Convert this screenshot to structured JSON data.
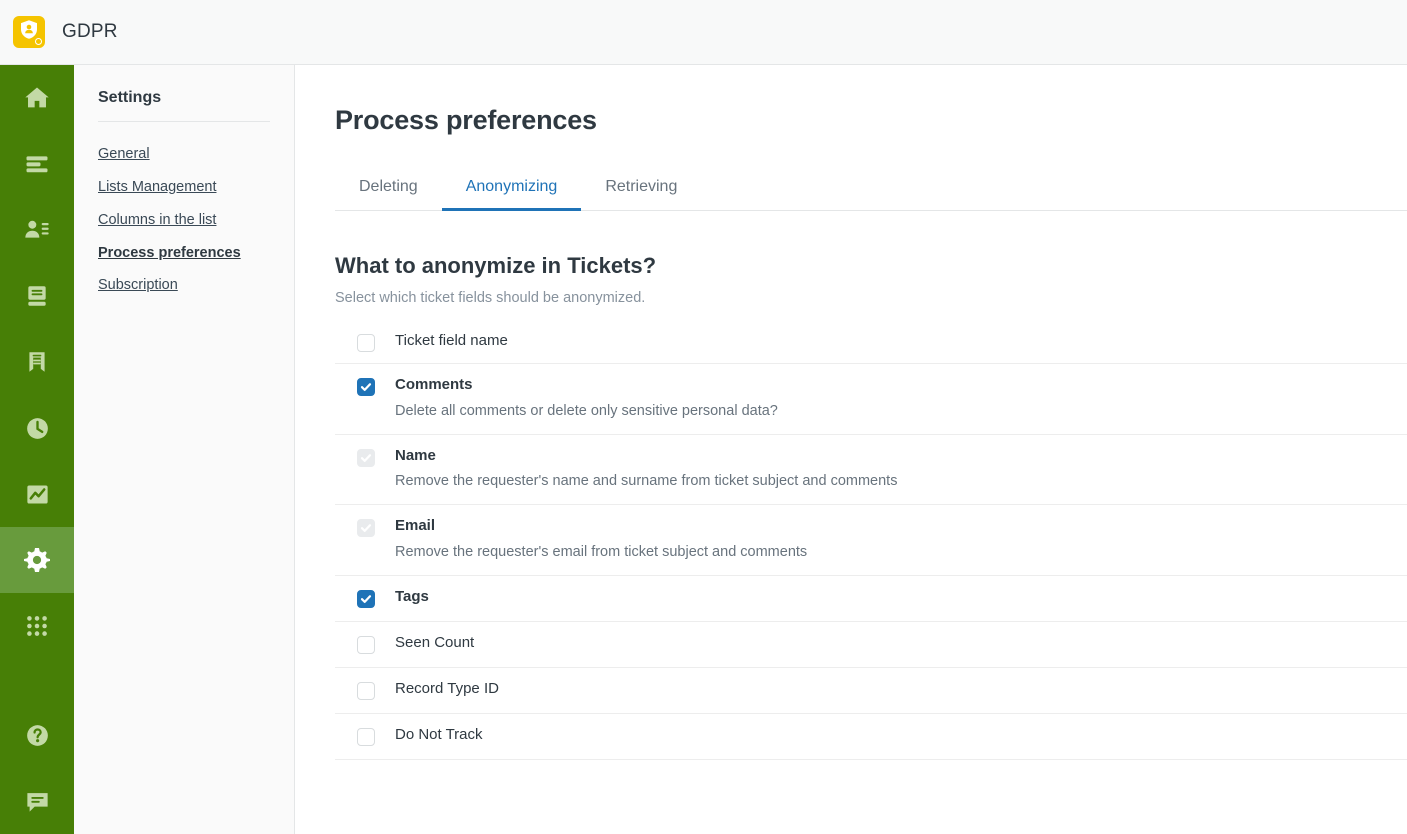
{
  "header": {
    "app_name": "GDPR",
    "logo_icon": "shield-person-icon",
    "logo_color": "#f5c400"
  },
  "rail": {
    "background_color": "#477f06",
    "active_background_color": "#689b3d",
    "items": [
      {
        "icon": "home-icon",
        "active": false
      },
      {
        "icon": "views-list-icon",
        "active": false
      },
      {
        "icon": "customers-user-icon",
        "active": false
      },
      {
        "icon": "database-icon",
        "active": false
      },
      {
        "icon": "book-report-icon",
        "active": false
      },
      {
        "icon": "clock-icon",
        "active": false
      },
      {
        "icon": "analytics-chart-icon",
        "active": false
      },
      {
        "icon": "gear-icon",
        "active": true
      },
      {
        "icon": "apps-grid-icon",
        "active": false
      }
    ],
    "bottom_items": [
      {
        "icon": "help-question-icon"
      },
      {
        "icon": "chat-bubble-icon"
      }
    ]
  },
  "settings_nav": {
    "title": "Settings",
    "items": [
      {
        "label": "General",
        "current": false
      },
      {
        "label": "Lists Management",
        "current": false
      },
      {
        "label": "Columns in the list",
        "current": false
      },
      {
        "label": "Process preferences",
        "current": true
      },
      {
        "label": "Subscription",
        "current": false
      }
    ]
  },
  "main": {
    "page_title": "Process preferences",
    "tabs": [
      {
        "label": "Deleting",
        "active": false
      },
      {
        "label": "Anonymizing",
        "active": true
      },
      {
        "label": "Retrieving",
        "active": false
      }
    ],
    "accent_color": "#1f73b7",
    "section_title": "What to anonymize in Tickets?",
    "section_subtitle": "Select which ticket fields should be anonymized.",
    "column_header": "Ticket field name",
    "rows": [
      {
        "label": "Comments",
        "description": "Delete all comments or delete only sensitive personal data?",
        "state": "checked"
      },
      {
        "label": "Name",
        "description": "Remove the requester's name and surname from ticket subject and comments",
        "state": "disabled"
      },
      {
        "label": "Email",
        "description": "Remove the requester's email from ticket subject and comments",
        "state": "disabled"
      },
      {
        "label": "Tags",
        "description": "",
        "state": "checked"
      },
      {
        "label": "Seen Count",
        "description": "",
        "state": "unchecked"
      },
      {
        "label": "Record Type ID",
        "description": "",
        "state": "unchecked"
      },
      {
        "label": "Do Not Track",
        "description": "",
        "state": "unchecked"
      }
    ]
  }
}
